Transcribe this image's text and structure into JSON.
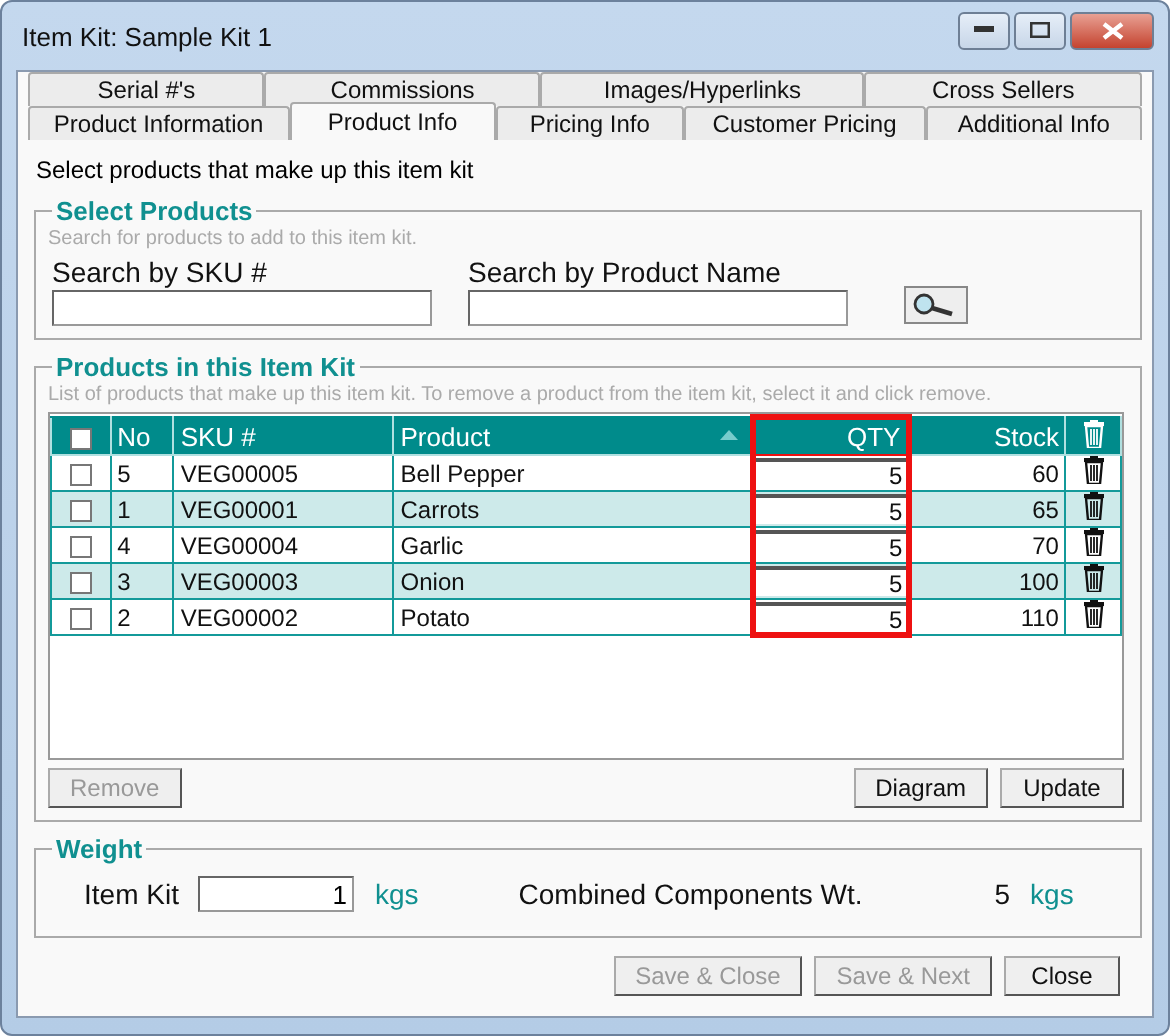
{
  "window": {
    "title": "Item Kit: Sample Kit 1"
  },
  "tab_rows": [
    [
      {
        "label": "Serial #'s",
        "selected": false
      },
      {
        "label": "Commissions",
        "selected": false
      },
      {
        "label": "Images/Hyperlinks",
        "selected": false
      },
      {
        "label": "Cross Sellers",
        "selected": false
      }
    ],
    [
      {
        "label": "Product Information",
        "selected": false
      },
      {
        "label": "Product Info",
        "selected": true
      },
      {
        "label": "Pricing Info",
        "selected": false
      },
      {
        "label": "Customer Pricing",
        "selected": false
      },
      {
        "label": "Additional Info",
        "selected": false
      }
    ]
  ],
  "intro": "Select products that make up this item kit",
  "select_products": {
    "title": "Select Products",
    "hint": "Search for products to add to this item kit.",
    "sku_label": "Search by SKU #",
    "name_label": "Search by Product Name"
  },
  "products": {
    "title": "Products in this Item Kit",
    "hint": "List of products that make up this item kit.  To remove a product from the item kit, select it and click remove.",
    "columns": [
      {
        "label": "No",
        "highlighted": false,
        "sorted": false
      },
      {
        "label": "SKU #",
        "highlighted": false,
        "sorted": false
      },
      {
        "label": "Product",
        "highlighted": false,
        "sorted": true
      },
      {
        "label": "QTY",
        "highlighted": true,
        "sorted": false
      },
      {
        "label": "Stock",
        "highlighted": false,
        "sorted": false
      }
    ],
    "header_checked": false,
    "rows": [
      {
        "checked": false,
        "no": "5",
        "sku": "VEG00005",
        "product": "Bell Pepper",
        "qty": "5",
        "stock": "60"
      },
      {
        "checked": false,
        "no": "1",
        "sku": "VEG00001",
        "product": "Carrots",
        "qty": "5",
        "stock": "65"
      },
      {
        "checked": false,
        "no": "4",
        "sku": "VEG00004",
        "product": "Garlic",
        "qty": "5",
        "stock": "70"
      },
      {
        "checked": false,
        "no": "3",
        "sku": "VEG00003",
        "product": "Onion",
        "qty": "5",
        "stock": "100"
      },
      {
        "checked": false,
        "no": "2",
        "sku": "VEG00002",
        "product": "Potato",
        "qty": "5",
        "stock": "110"
      }
    ],
    "buttons": [
      {
        "label": "Remove",
        "disabled": true
      },
      {
        "label": "Diagram",
        "disabled": false
      },
      {
        "label": "Update",
        "disabled": false
      }
    ]
  },
  "weight": {
    "title": "Weight",
    "item_kit_label": "Item Kit",
    "item_kit_value": "1",
    "unit": "kgs",
    "combined_label": "Combined Components Wt.",
    "combined_value": "5",
    "combined_unit": "kgs"
  },
  "footer_buttons": [
    {
      "label": "Save & Close",
      "disabled": true
    },
    {
      "label": "Save & Next",
      "disabled": true
    },
    {
      "label": "Close",
      "disabled": false
    }
  ]
}
